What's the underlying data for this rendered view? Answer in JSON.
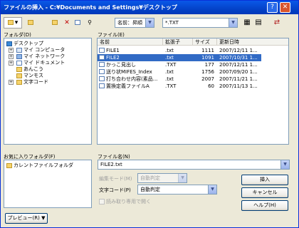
{
  "window": {
    "title": "ファイルの挿入 - C:¥Documents and Settings¥デスクトップ",
    "help_btn": "?",
    "close_btn": "✕"
  },
  "toolbar": {
    "icon_folder": "▤",
    "new_folder": "📁",
    "delete": "✕",
    "properties": "▤",
    "search": "🔍",
    "sort": "名前：昇順",
    "filter": "*.TXT"
  },
  "folder_panel": {
    "label": "フォルダ(D)",
    "items": [
      "デスクトップ",
      "マイ コンピュータ",
      "マイ ネットワーク",
      "マイ ドキュメント",
      "あんこう",
      "マンモス",
      "文字コード"
    ]
  },
  "file_panel": {
    "label": "ファイル(E)",
    "columns": [
      "名前",
      "拡張子",
      "サイズ",
      "更新日時"
    ],
    "rows": [
      {
        "name": "FILE1",
        "ext": ".txt",
        "size": "1111",
        "date": "2007/12/11 1..."
      },
      {
        "name": "FILE2",
        "ext": ".txt",
        "size": "1091",
        "date": "2007/10/31 1...",
        "selected": true
      },
      {
        "name": "かっこ見出し",
        "ext": ".TXT",
        "size": "177",
        "date": "2007/12/11 1..."
      },
      {
        "name": "送り状MIFES_Index",
        "ext": ".txt",
        "size": "1756",
        "date": "2007/09/20 1..."
      },
      {
        "name": "打ち合わせ内容(素品...",
        "ext": ".txt",
        "size": "2007",
        "date": "2007/11/21 1..."
      },
      {
        "name": "置換定義ファイルA",
        "ext": ".TXT",
        "size": "60",
        "date": "2007/11/13 1..."
      }
    ]
  },
  "favorites": {
    "label": "お気に入りフォルダ(F)",
    "items": [
      "カレントファイルフォルダ"
    ]
  },
  "file_name": {
    "label": "ファイル名(N)",
    "value": "FILE2.txt"
  },
  "open_mode": {
    "label": "編集モード(M)",
    "value": "自動判定"
  },
  "char_code": {
    "label": "文字コード(P)",
    "value": "自動判定"
  },
  "readonly": {
    "label": "読み取り専用で開く"
  },
  "buttons": {
    "insert": "挿入",
    "cancel": "キャンセル",
    "help": "ヘルプ(H)",
    "preview": "プレビュー(R) ▼"
  },
  "colors": {
    "title_bar": "#0a58e8",
    "selection": "#316ac5",
    "face": "#ece9d8"
  }
}
